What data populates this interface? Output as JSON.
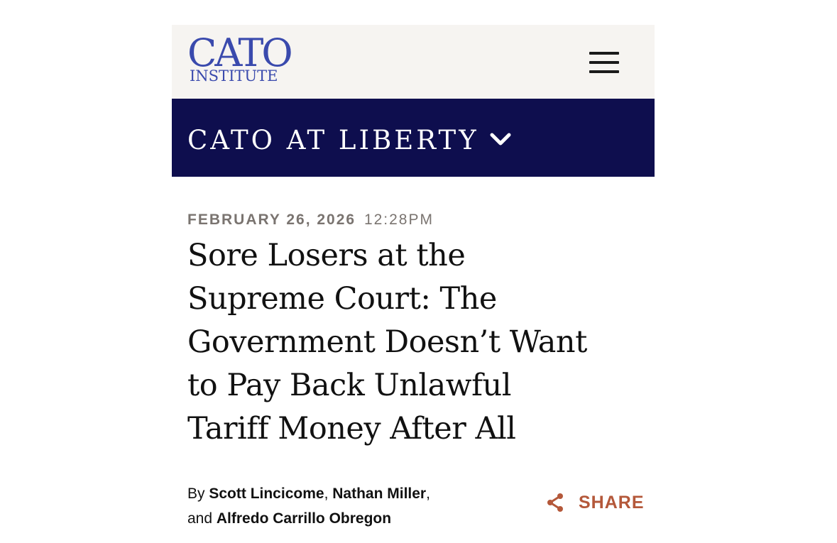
{
  "header": {
    "logo_main": "CATO",
    "logo_sub": "INSTITUTE",
    "menu_icon": "hamburger-menu-icon"
  },
  "section_nav": {
    "title": "CATO AT LIBERTY",
    "chevron_icon": "chevron-down-icon"
  },
  "article": {
    "date": "FEBRUARY 26, 2026",
    "time": "12:28PM",
    "headline_lines": [
      "Sore Losers at the",
      "Supreme Court: The",
      "Government Doesn’t Want",
      "to Pay Back Unlawful",
      "Tariff Money After All"
    ],
    "byline": {
      "prefix": "By",
      "authors": [
        "Scott Lincicome",
        "Nathan Miller",
        "Alfredo Carrillo Obregon"
      ],
      "separator": ",",
      "conjunction": "and"
    },
    "share_label": "SHARE",
    "share_icon": "share-icon"
  },
  "colors": {
    "brand_blue": "#3a4aad",
    "navbar_bg": "#0e0e4e",
    "topbar_bg": "#f6f4f1",
    "share_accent": "#b4583a",
    "dateline": "#7a7470"
  }
}
